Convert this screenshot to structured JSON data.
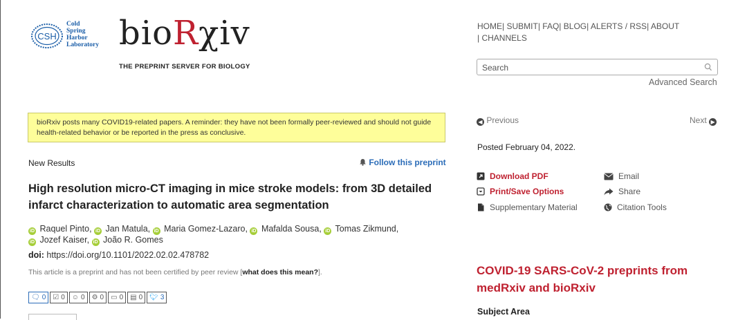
{
  "logo": {
    "csh_badge": "CSH",
    "csh_lines": [
      "Cold",
      "Spring",
      "Harbor",
      "Laboratory"
    ],
    "brand_prefix": "bio",
    "brand_r": "R",
    "brand_suffix": "χiv",
    "tagline": "THE PREPRINT SERVER FOR BIOLOGY"
  },
  "nav": {
    "items": [
      "HOME",
      "SUBMIT",
      "FAQ",
      "BLOG",
      "ALERTS / RSS",
      "ABOUT",
      "CHANNELS"
    ],
    "separator": "|"
  },
  "search": {
    "placeholder": "Search",
    "advanced": "Advanced Search"
  },
  "notice": "bioRxiv posts many COVID19-related papers. A reminder: they have not been formally peer-reviewed and should not guide health-related behavior or be reported in the press as conclusive.",
  "article": {
    "section": "New Results",
    "follow": "Follow this preprint",
    "title": "High resolution micro-CT imaging in mice stroke models: from 3D detailed infarct characterization to automatic area segmentation",
    "authors": [
      "Raquel Pinto",
      "Jan Matula",
      "Maria Gomez-Lazaro",
      "Mafalda Sousa",
      "Tomas Zikmund",
      "Jozef Kaiser",
      "João R. Gomes"
    ],
    "doi_label": "doi:",
    "doi": "https://doi.org/10.1101/2022.02.02.478782",
    "note_prefix": "This article is a preprint and has not been certified by peer review [",
    "note_link": "what does this mean?",
    "note_suffix": "]."
  },
  "counters": [
    {
      "icon": "comment-icon",
      "value": "0"
    },
    {
      "icon": "review-icon",
      "value": "0"
    },
    {
      "icon": "group-icon",
      "value": "0"
    },
    {
      "icon": "gears-icon",
      "value": "0"
    },
    {
      "icon": "monitor-icon",
      "value": "0"
    },
    {
      "icon": "film-icon",
      "value": "0"
    },
    {
      "icon": "twitter-icon",
      "value": "3"
    }
  ],
  "sidebar": {
    "previous": "Previous",
    "next": "Next",
    "posted": "Posted February 04, 2022.",
    "download_pdf": "Download PDF",
    "print_save": "Print/Save Options",
    "supplementary": "Supplementary Material",
    "email": "Email",
    "share": "Share",
    "citation": "Citation Tools",
    "covid_heading": "COVID-19 SARS-CoV-2 preprints from medRxiv and bioRxiv",
    "subject_area": "Subject Area"
  },
  "colors": {
    "brand_red": "#bf2130",
    "link_blue": "#2b6cb8",
    "notice_yellow": "#fefe9a",
    "orcid_green": "#a6ce39"
  }
}
